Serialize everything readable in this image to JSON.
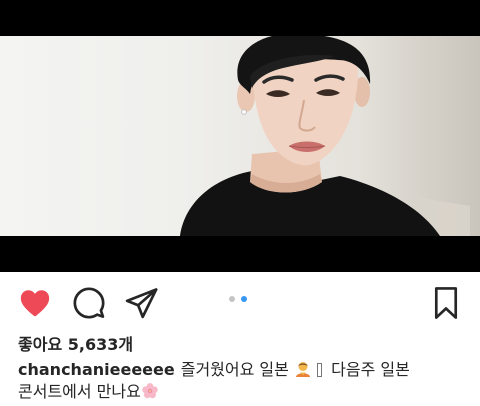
{
  "post": {
    "likes_label": "좋아요",
    "likes_count": "5,633개",
    "username": "chanchanieeeeee",
    "caption_part1": "즐거웠어요 일본",
    "caption_part2": "다음주 일본",
    "caption_part3": "콘서트에서 만나요"
  },
  "carousel": {
    "total": 2,
    "active": 2
  },
  "colors": {
    "heart": "#ed4956",
    "active_dot": "#3897f0",
    "inactive_dot": "#c4c4c4",
    "text": "#262626"
  },
  "icons": [
    "heart-icon",
    "comment-icon",
    "share-icon",
    "bookmark-icon"
  ]
}
